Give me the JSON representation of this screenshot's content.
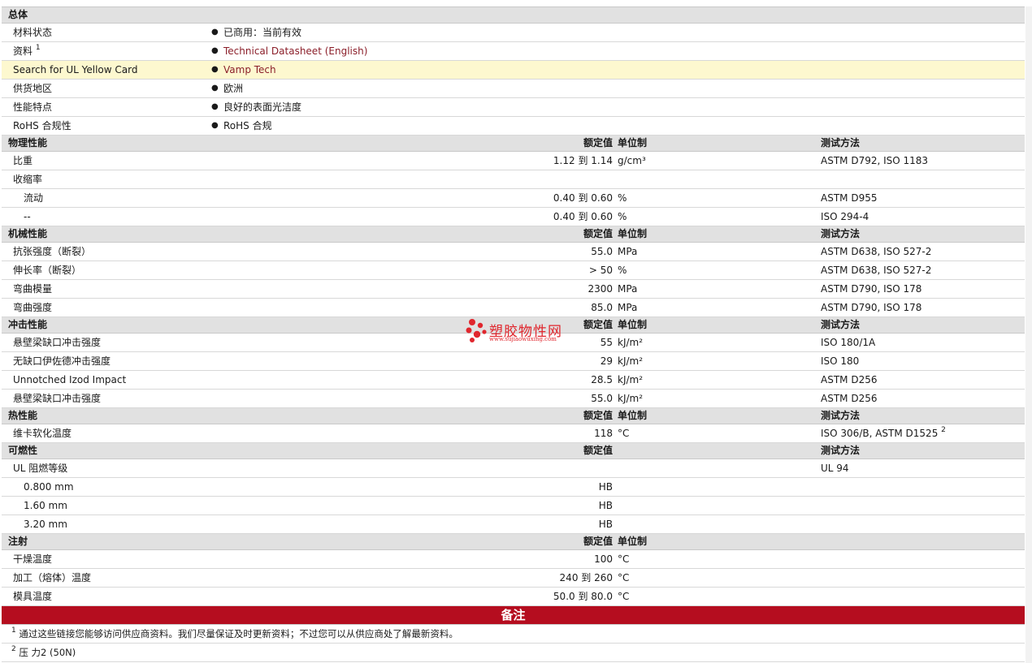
{
  "general": {
    "title": "总体",
    "rows": [
      {
        "label": "材料状态",
        "sup": "",
        "value": "已商用：当前有效",
        "link": false,
        "highlight": false
      },
      {
        "label": "资料",
        "sup": "1",
        "value": "Technical Datasheet (English)",
        "link": true,
        "highlight": false
      },
      {
        "label": "Search for UL Yellow Card",
        "sup": "",
        "value": "Vamp Tech",
        "link": true,
        "highlight": true
      },
      {
        "label": "供货地区",
        "sup": "",
        "value": "欧洲",
        "link": false,
        "highlight": false
      },
      {
        "label": "性能特点",
        "sup": "",
        "value": "良好的表面光洁度",
        "link": false,
        "highlight": false
      },
      {
        "label": "RoHS 合规性",
        "sup": "",
        "value": "RoHS 合规",
        "link": false,
        "highlight": false
      }
    ]
  },
  "sections": [
    {
      "title": "物理性能",
      "nominal_header": "额定值",
      "unit_header": "单位制",
      "method_header": "测试方法",
      "rows": [
        {
          "label": "比重",
          "indent": false,
          "nominal": "1.12 到  1.14",
          "unit": "g/cm³",
          "method": "ASTM D792, ISO 1183",
          "sup": ""
        },
        {
          "label": "收缩率",
          "indent": false,
          "nominal": "",
          "unit": "",
          "method": "",
          "sup": ""
        },
        {
          "label": "流动",
          "indent": true,
          "nominal": "0.40 到  0.60",
          "unit": "%",
          "method": "ASTM D955",
          "sup": ""
        },
        {
          "label": "--",
          "indent": true,
          "nominal": "0.40 到  0.60",
          "unit": "%",
          "method": "ISO 294-4",
          "sup": ""
        }
      ]
    },
    {
      "title": "机械性能",
      "nominal_header": "额定值",
      "unit_header": "单位制",
      "method_header": "测试方法",
      "rows": [
        {
          "label": "抗张强度（断裂）",
          "indent": false,
          "nominal": "55.0",
          "unit": "MPa",
          "method": "ASTM D638, ISO 527-2",
          "sup": ""
        },
        {
          "label": "伸长率（断裂）",
          "indent": false,
          "nominal": "> 50",
          "unit": "%",
          "method": "ASTM D638, ISO 527-2",
          "sup": ""
        },
        {
          "label": "弯曲模量",
          "indent": false,
          "nominal": "2300",
          "unit": "MPa",
          "method": "ASTM D790, ISO 178",
          "sup": ""
        },
        {
          "label": "弯曲强度",
          "indent": false,
          "nominal": "85.0",
          "unit": "MPa",
          "method": "ASTM D790, ISO 178",
          "sup": ""
        }
      ]
    },
    {
      "title": "冲击性能",
      "nominal_header": "额定值",
      "unit_header": "单位制",
      "method_header": "测试方法",
      "rows": [
        {
          "label": "悬壁梁缺口冲击强度",
          "indent": false,
          "nominal": "55",
          "unit": "kJ/m²",
          "method": "ISO 180/1A",
          "sup": ""
        },
        {
          "label": "无缺口伊佐德冲击强度",
          "indent": false,
          "nominal": "29",
          "unit": "kJ/m²",
          "method": "ISO 180",
          "sup": ""
        },
        {
          "label": "Unnotched Izod Impact",
          "indent": false,
          "nominal": "28.5",
          "unit": "kJ/m²",
          "method": "ASTM D256",
          "sup": ""
        },
        {
          "label": "悬壁梁缺口冲击强度",
          "indent": false,
          "nominal": "55.0",
          "unit": "kJ/m²",
          "method": "ASTM D256",
          "sup": ""
        }
      ]
    },
    {
      "title": "热性能",
      "nominal_header": "额定值",
      "unit_header": "单位制",
      "method_header": "测试方法",
      "rows": [
        {
          "label": "维卡软化温度",
          "indent": false,
          "nominal": "118",
          "unit": "°C",
          "method": "ISO 306/B, ASTM D1525",
          "sup": "2"
        }
      ]
    },
    {
      "title": "可燃性",
      "nominal_header": "额定值",
      "unit_header": "",
      "method_header": "测试方法",
      "rows": [
        {
          "label": "UL 阻燃等级",
          "indent": false,
          "nominal": "",
          "unit": "",
          "method": "UL 94",
          "sup": ""
        },
        {
          "label": "0.800 mm",
          "indent": true,
          "nominal": "HB",
          "unit": "",
          "method": "",
          "sup": ""
        },
        {
          "label": "1.60 mm",
          "indent": true,
          "nominal": "HB",
          "unit": "",
          "method": "",
          "sup": ""
        },
        {
          "label": "3.20 mm",
          "indent": true,
          "nominal": "HB",
          "unit": "",
          "method": "",
          "sup": ""
        }
      ]
    },
    {
      "title": "注射",
      "nominal_header": "额定值",
      "unit_header": "单位制",
      "method_header": "",
      "rows": [
        {
          "label": "干燥温度",
          "indent": false,
          "nominal": "100",
          "unit": "°C",
          "method": "",
          "sup": ""
        },
        {
          "label": "加工（熔体）温度",
          "indent": false,
          "nominal": "240 到  260",
          "unit": "°C",
          "method": "",
          "sup": ""
        },
        {
          "label": "模具温度",
          "indent": false,
          "nominal": "50.0 到  80.0",
          "unit": "°C",
          "method": "",
          "sup": ""
        }
      ]
    }
  ],
  "remarks": {
    "title": "备注",
    "notes": [
      {
        "num": "1",
        "text": "通过这些链接您能够访问供应商资料。我们尽量保证及时更新资料；不过您可以从供应商处了解最新资料。"
      },
      {
        "num": "2",
        "text": "压  力2 (50N)"
      }
    ]
  },
  "watermark": {
    "title": "塑胶物性网",
    "url": "www.sujiaowuxing.com",
    "color": "#e0262d"
  },
  "colors": {
    "section_bg": "#e1e1e1",
    "highlight_bg": "#fdf8cf",
    "link": "#8b1f2a",
    "remarks_bg": "#b50d1f"
  }
}
